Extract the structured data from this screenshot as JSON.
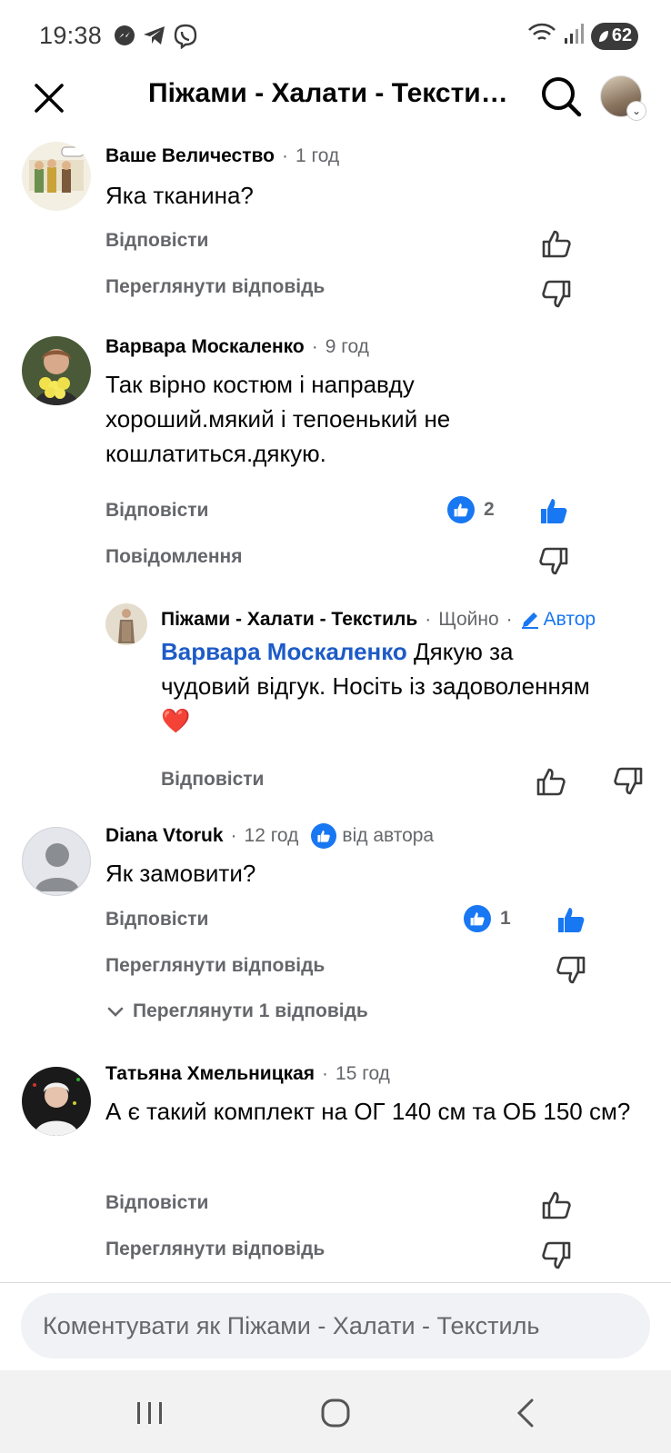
{
  "status_bar": {
    "time": "19:38",
    "battery": "62",
    "notification_icons": [
      "messenger-icon",
      "telegram-icon",
      "viber-icon"
    ]
  },
  "header": {
    "title": "Піжами - Халати - Текстиль",
    "close_icon": "close-icon",
    "search_icon": "search-icon"
  },
  "comments": [
    {
      "author": "Ваше Величество",
      "time": "1 год",
      "text": "Яка тканина?",
      "reply_label": "Відповісти",
      "secondary_label": "Переглянути відповідь"
    },
    {
      "author": "Варвара Москаленко",
      "time": "9 год",
      "text": "Так вірно костюм і направду хороший.мякий і тепоенький не кошлатиться.дякую.",
      "reply_label": "Відповісти",
      "secondary_label": "Повідомлення",
      "like_count": "2",
      "liked": true
    },
    {
      "author": "Diana Vtoruk",
      "time": "12 год",
      "badge": "від автора",
      "text": "Як замовити?",
      "reply_label": "Відповісти",
      "secondary_label": "Переглянути відповідь",
      "like_count": "1",
      "liked": true,
      "view_replies_label": "Переглянути 1 відповідь"
    },
    {
      "author": "Татьяна Хмельницкая",
      "time": "15 год",
      "text": "А є такий комплект на ОГ 140 см та ОБ 150 см?",
      "reply_label": "Відповісти",
      "secondary_label": "Переглянути відповідь"
    }
  ],
  "reply": {
    "author": "Піжами - Халати - Текстиль",
    "time": "Щойно",
    "author_tag": "Автор",
    "mention": "Варвара Москаленко",
    "text": " Дякую за чудовий відгук. Носіть із задоволенням",
    "emoji": "❤️",
    "reply_label": "Відповісти"
  },
  "composer": {
    "placeholder": "Коментувати як Піжами - Халати - Текстиль"
  },
  "colors": {
    "accent": "#1877f2",
    "mention": "#1d5bc7",
    "secondary_text": "#65676b"
  }
}
